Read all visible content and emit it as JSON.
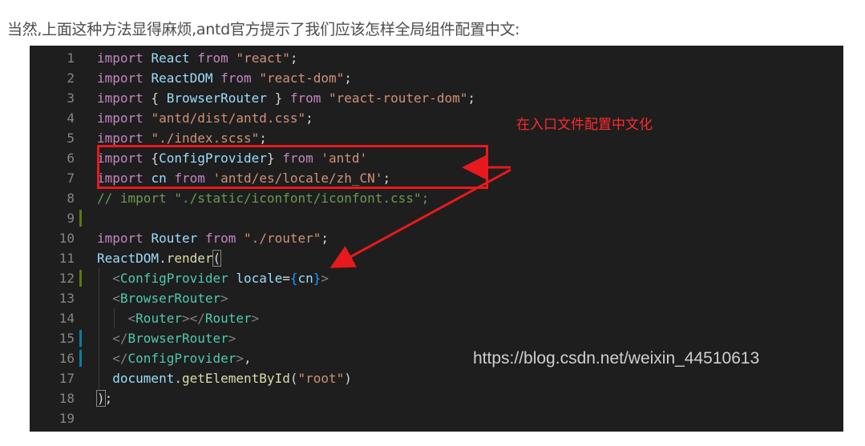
{
  "intro_text": "当然,上面这种方法显得麻烦,antd官方提示了我们应该怎样全局组件配置中文:",
  "annotation_text": "在入口文件配置中文化",
  "watermark": "https://blog.csdn.net/weixin_44510613",
  "colors": {
    "background": "#1e1e1e",
    "highlight_box": "#e8191c",
    "annotation": "#ff2a2a"
  },
  "lines": [
    {
      "n": "1",
      "gutter": "",
      "tokens": [
        [
          "kw",
          "import"
        ],
        [
          "pl",
          " "
        ],
        [
          "var",
          "React"
        ],
        [
          "pl",
          " "
        ],
        [
          "kw",
          "from"
        ],
        [
          "pl",
          " "
        ],
        [
          "str",
          "\"react\""
        ],
        [
          "pl",
          ";"
        ]
      ]
    },
    {
      "n": "2",
      "gutter": "",
      "tokens": [
        [
          "kw",
          "import"
        ],
        [
          "pl",
          " "
        ],
        [
          "var",
          "ReactDOM"
        ],
        [
          "pl",
          " "
        ],
        [
          "kw",
          "from"
        ],
        [
          "pl",
          " "
        ],
        [
          "str",
          "\"react-dom\""
        ],
        [
          "pl",
          ";"
        ]
      ]
    },
    {
      "n": "3",
      "gutter": "",
      "tokens": [
        [
          "kw",
          "import"
        ],
        [
          "pl",
          " { "
        ],
        [
          "var",
          "BrowserRouter"
        ],
        [
          "pl",
          " } "
        ],
        [
          "kw",
          "from"
        ],
        [
          "pl",
          " "
        ],
        [
          "str",
          "\"react-router-dom\""
        ],
        [
          "pl",
          ";"
        ]
      ]
    },
    {
      "n": "4",
      "gutter": "",
      "tokens": [
        [
          "kw",
          "import"
        ],
        [
          "pl",
          " "
        ],
        [
          "str",
          "\"antd/dist/antd.css\""
        ],
        [
          "pl",
          ";"
        ]
      ]
    },
    {
      "n": "5",
      "gutter": "",
      "tokens": [
        [
          "kw",
          "import"
        ],
        [
          "pl",
          " "
        ],
        [
          "str",
          "\"./index.scss\""
        ],
        [
          "pl",
          ";"
        ]
      ]
    },
    {
      "n": "6",
      "gutter": "",
      "tokens": [
        [
          "kw",
          "import"
        ],
        [
          "pl",
          " {"
        ],
        [
          "var",
          "ConfigProvider"
        ],
        [
          "pl",
          "} "
        ],
        [
          "kw",
          "from"
        ],
        [
          "pl",
          " "
        ],
        [
          "str",
          "'antd'"
        ]
      ]
    },
    {
      "n": "7",
      "gutter": "",
      "tokens": [
        [
          "kw",
          "import"
        ],
        [
          "pl",
          " "
        ],
        [
          "var",
          "cn"
        ],
        [
          "pl",
          " "
        ],
        [
          "kw",
          "from"
        ],
        [
          "pl",
          " "
        ],
        [
          "str",
          "'antd/es/locale/zh_CN'"
        ],
        [
          "pl",
          ";"
        ]
      ]
    },
    {
      "n": "8",
      "gutter": "",
      "tokens": [
        [
          "com",
          "// import \"./static/iconfont/iconfont.css\";"
        ]
      ]
    },
    {
      "n": "9",
      "gutter": "green",
      "tokens": []
    },
    {
      "n": "10",
      "gutter": "",
      "tokens": [
        [
          "kw",
          "import"
        ],
        [
          "pl",
          " "
        ],
        [
          "var",
          "Router"
        ],
        [
          "pl",
          " "
        ],
        [
          "kw",
          "from"
        ],
        [
          "pl",
          " "
        ],
        [
          "str",
          "\"./router\""
        ],
        [
          "pl",
          ";"
        ]
      ]
    },
    {
      "n": "11",
      "gutter": "",
      "tokens": [
        [
          "var",
          "ReactDOM"
        ],
        [
          "pl",
          "."
        ],
        [
          "fn",
          "render"
        ],
        [
          "box",
          "("
        ]
      ]
    },
    {
      "n": "12",
      "gutter": "green",
      "tokens": [
        [
          "pl",
          "  "
        ],
        [
          "tag",
          "<"
        ],
        [
          "tn",
          "ConfigProvider"
        ],
        [
          "pl",
          " "
        ],
        [
          "attr",
          "locale"
        ],
        [
          "pl",
          "="
        ],
        [
          "brace2",
          "{"
        ],
        [
          "var",
          "cn"
        ],
        [
          "brace2",
          "}"
        ],
        [
          "tag",
          ">"
        ]
      ]
    },
    {
      "n": "13",
      "gutter": "",
      "tokens": [
        [
          "pl",
          "  "
        ],
        [
          "tag",
          "<"
        ],
        [
          "tn",
          "BrowserRouter"
        ],
        [
          "tag",
          ">"
        ]
      ]
    },
    {
      "n": "14",
      "gutter": "",
      "tokens": [
        [
          "pl",
          "    "
        ],
        [
          "tag",
          "<"
        ],
        [
          "tn",
          "Router"
        ],
        [
          "tag",
          "></"
        ],
        [
          "tn",
          "Router"
        ],
        [
          "tag",
          ">"
        ]
      ]
    },
    {
      "n": "15",
      "gutter": "blue",
      "tokens": [
        [
          "pl",
          "  "
        ],
        [
          "tag",
          "</"
        ],
        [
          "tn",
          "BrowserRouter"
        ],
        [
          "tag",
          ">"
        ]
      ]
    },
    {
      "n": "16",
      "gutter": "blue",
      "tokens": [
        [
          "pl",
          "  "
        ],
        [
          "tag",
          "</"
        ],
        [
          "tn",
          "ConfigProvider"
        ],
        [
          "tag",
          ">"
        ],
        [
          "pl",
          ","
        ]
      ]
    },
    {
      "n": "17",
      "gutter": "",
      "tokens": [
        [
          "pl",
          "  "
        ],
        [
          "var",
          "document"
        ],
        [
          "pl",
          "."
        ],
        [
          "fn",
          "getElementById"
        ],
        [
          "pl",
          "("
        ],
        [
          "str",
          "\"root\""
        ],
        [
          "pl",
          ")"
        ]
      ]
    },
    {
      "n": "18",
      "gutter": "",
      "tokens": [
        [
          "box",
          ")"
        ],
        [
          "pl",
          ";"
        ]
      ]
    },
    {
      "n": "19",
      "gutter": "",
      "tokens": []
    }
  ]
}
